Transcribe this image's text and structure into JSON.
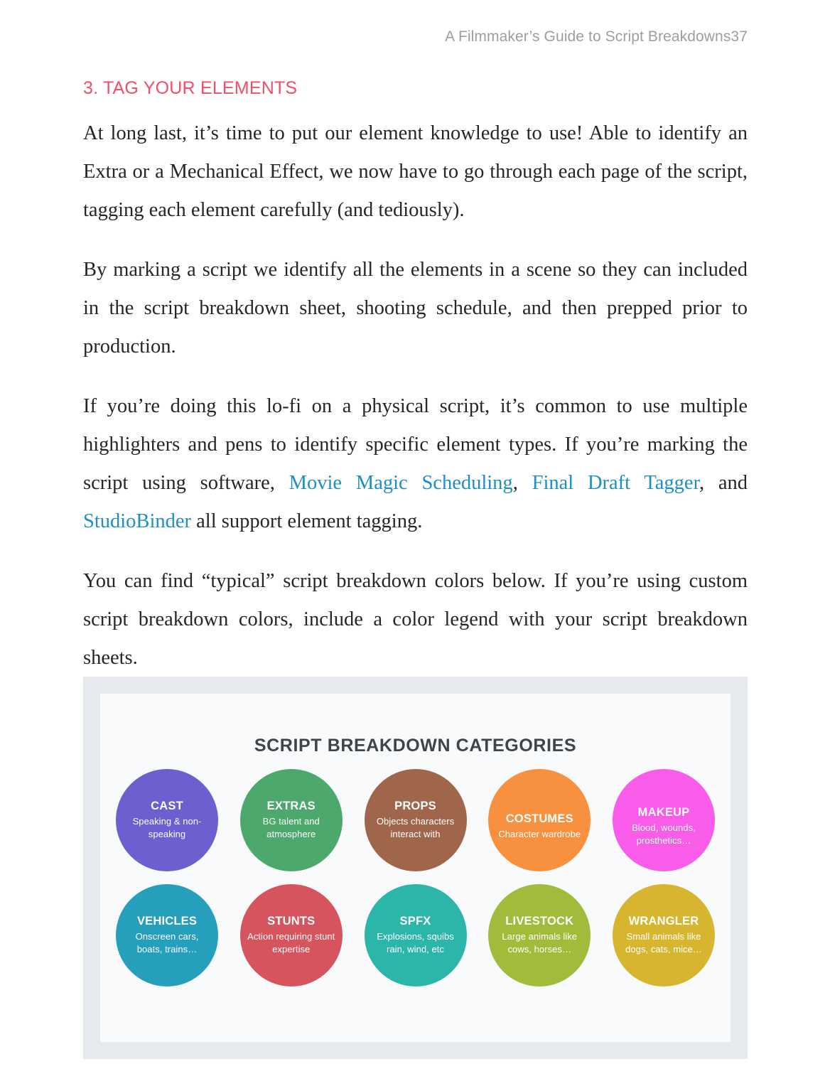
{
  "header": {
    "running_head": "A Filmmaker’s Guide to Script Breakdowns37"
  },
  "section": {
    "title": "3. TAG YOUR ELEMENTS",
    "title_color": "#ef4f6b"
  },
  "paragraphs": {
    "p1": "At long last, it’s time to put our element knowledge to use! Able to identify an Extra or a Mechanical Effect, we now have to go through each page of the script, tagging each element carefully (and tediously).",
    "p2": "By marking a script we identify all the elements in a scene so they can included in the script breakdown sheet, shooting schedule, and then prepped prior to production.",
    "p3_before": "If you’re doing this lo-fi on a physical script, it’s common to use multiple highlighters and pens to identify specific element types. If you’re marking the script using software, ",
    "p3_link1": "Movie Magic Scheduling",
    "p3_mid1": ", ",
    "p3_link2": "Final Draft Tagger",
    "p3_mid2": ", and ",
    "p3_link3": "StudioBinder",
    "p3_after": " all support element tagging.",
    "p4": "You can find “typical” script breakdown colors below. If you’re using custom script breakdown colors, include a color legend with your script breakdown sheets.",
    "link_color": "#1f8fc0"
  },
  "figure": {
    "title": "SCRIPT BREAKDOWN CATEGORIES",
    "frame_color": "#e6eaee",
    "panel_color": "#f8fafb",
    "rows": [
      [
        {
          "name": "CAST",
          "desc": "Speaking & non-speaking",
          "color": "#6C5FD0"
        },
        {
          "name": "EXTRAS",
          "desc": "BG talent and atmosphere",
          "color": "#4CA86C"
        },
        {
          "name": "PROPS",
          "desc": "Objects characters interact with",
          "color": "#A0664C"
        },
        {
          "name": "COSTUMES",
          "desc": "Character wardrobe",
          "color": "#F7913F"
        },
        {
          "name": "MAKEUP",
          "desc": "Blood, wounds, prosthetics…",
          "color": "#F95CE8"
        }
      ],
      [
        {
          "name": "VEHICLES",
          "desc": "Onscreen cars, boats, trains…",
          "color": "#259FBC"
        },
        {
          "name": "STUNTS",
          "desc": "Action requiring stunt expertise",
          "color": "#D5545E"
        },
        {
          "name": "SPFX",
          "desc": "Explosions, squibs rain, wind, etc",
          "color": "#2CB6AA"
        },
        {
          "name": "LIVESTOCK",
          "desc": "Large animals like cows, horses…",
          "color": "#A2BB3A"
        },
        {
          "name": "WRANGLER",
          "desc": "Small animals like dogs, cats, mice…",
          "color": "#D7B52F"
        }
      ]
    ]
  }
}
